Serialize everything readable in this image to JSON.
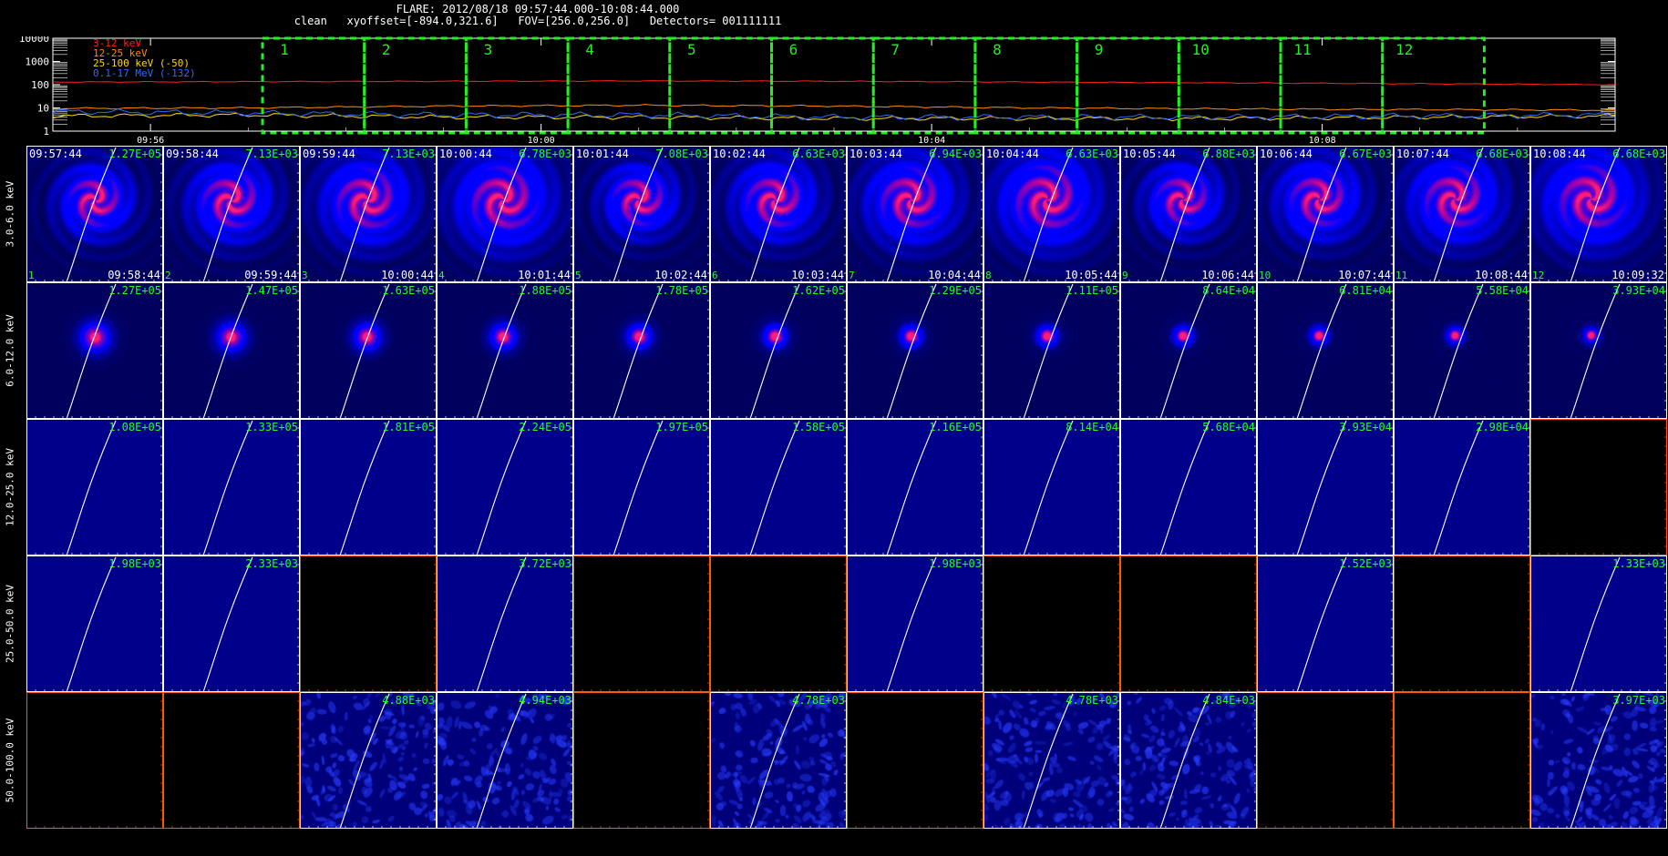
{
  "header": {
    "line1": "FLARE: 2012/08/18 09:57:44.000-10:08:44.000",
    "line2": "clean   xyoffset=[-894.0,321.6]   FOV=[256.0,256.0]   Detectors= 001111111"
  },
  "chart_data": {
    "type": "line",
    "title": "FLARE: 2012/08/18 09:57:44.000-10:08:44.000",
    "y_scale": "log",
    "ylim": [
      1,
      10000
    ],
    "y_ticks": [
      "10000",
      "1000",
      "100",
      "10",
      "1"
    ],
    "x_ticks": [
      "09:56",
      "10:00",
      "10:04",
      "10:08"
    ],
    "x_range": [
      "09:55:00",
      "10:11:00"
    ],
    "grid": false,
    "legend_position": "top-left",
    "series": [
      {
        "name": "3-12 keV",
        "color": "#ff2020",
        "x": [
          "09:55:00",
          "09:57:00",
          "09:59:00",
          "10:01:00",
          "10:03:00",
          "10:05:00",
          "10:07:00",
          "10:09:00",
          "10:11:00"
        ],
        "y": [
          130,
          135,
          140,
          145,
          140,
          130,
          120,
          110,
          100
        ]
      },
      {
        "name": "12-25 keV",
        "color": "#ff8a00",
        "x": [
          "09:55:00",
          "09:57:00",
          "09:59:00",
          "10:01:00",
          "10:03:00",
          "10:05:00",
          "10:07:00",
          "10:09:00",
          "10:11:00"
        ],
        "y": [
          9.5,
          10,
          12,
          13,
          12,
          10,
          9,
          8.5,
          8
        ]
      },
      {
        "name": "25-100 keV (-50)",
        "color": "#ffd800",
        "x": [
          "09:55:00",
          "09:57:00",
          "09:59:00",
          "10:01:00",
          "10:03:00",
          "10:05:00",
          "10:07:00",
          "10:09:00",
          "10:11:00"
        ],
        "y": [
          4.5,
          5,
          4,
          4,
          3.5,
          3.5,
          3.5,
          4,
          4.5
        ]
      },
      {
        "name": "0.1-17 MeV (-132)",
        "color": "#2a6cff",
        "x": [
          "09:55:00",
          "09:57:00",
          "09:59:00",
          "10:01:00",
          "10:03:00",
          "10:05:00",
          "10:07:00",
          "10:09:00",
          "10:11:00"
        ],
        "y": [
          7,
          6,
          5,
          5,
          4,
          4,
          4,
          4.5,
          5
        ]
      }
    ],
    "intervals": [
      "1",
      "2",
      "3",
      "4",
      "5",
      "6",
      "7",
      "8",
      "9",
      "10",
      "11",
      "12"
    ],
    "energy_bands": [
      "3.0-6.0 keV",
      "6.0-12.0 keV",
      "12.0-25.0 keV",
      "25.0-50.0 keV",
      "50.0-100.0 keV"
    ],
    "images": [
      {
        "row": 0,
        "start_times": [
          "09:57:44",
          "09:58:44",
          "09:59:44",
          "10:00:44",
          "10:01:44",
          "10:02:44",
          "10:03:44",
          "10:04:44",
          "10:05:44",
          "10:06:44",
          "10:07:44",
          "10:08:44"
        ],
        "end_times": [
          "09:58:44",
          "09:59:44",
          "10:00:44",
          "10:01:44",
          "10:02:44",
          "10:03:44",
          "10:04:44",
          "10:05:44",
          "10:06:44",
          "10:07:44",
          "10:08:44",
          "10:09:32"
        ],
        "peaks": [
          "1.27E+05",
          "7.13E+03",
          "7.13E+03",
          "6.78E+03",
          "7.08E+03",
          "6.63E+03",
          "6.94E+03",
          "6.63E+03",
          "6.88E+03",
          "6.67E+03",
          "6.68E+03",
          "6.68E+03"
        ]
      },
      {
        "row": 1,
        "peaks": [
          "1.27E+05",
          "1.47E+05",
          "1.63E+05",
          "1.88E+05",
          "1.78E+05",
          "1.62E+05",
          "1.29E+05",
          "1.11E+05",
          "8.64E+04",
          "6.81E+04",
          "5.58E+04",
          "3.93E+04"
        ]
      },
      {
        "row": 2,
        "peaks": [
          "1.08E+05",
          "1.33E+05",
          "1.81E+05",
          "2.24E+05",
          "1.97E+05",
          "1.58E+05",
          "1.16E+05",
          "8.14E+04",
          "5.68E+04",
          "3.93E+04",
          "2.98E+04",
          ""
        ]
      },
      {
        "row": 3,
        "peaks": [
          "1.98E+03",
          "2.33E+03",
          "",
          "3.72E+03",
          "",
          "",
          "1.98E+03",
          "",
          "",
          "1.52E+03",
          "",
          "1.33E+03"
        ]
      },
      {
        "row": 4,
        "peaks": [
          "",
          "",
          "4.88E+03",
          "4.94E+03",
          "",
          "4.78E+03",
          "",
          "4.78E+03",
          "4.84E+03",
          "",
          "",
          "3.97E+03"
        ]
      }
    ]
  }
}
